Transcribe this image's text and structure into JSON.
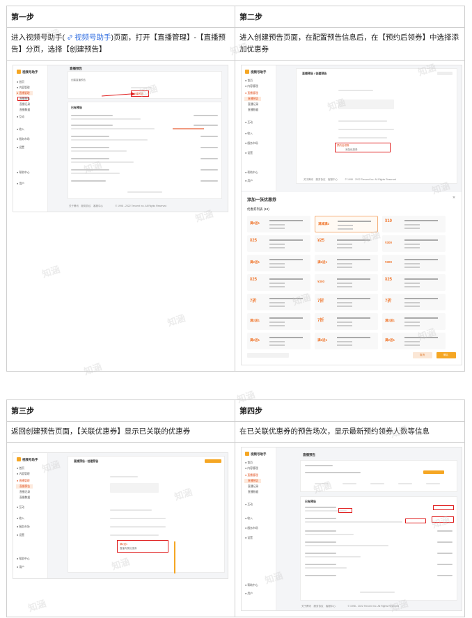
{
  "steps": [
    {
      "header": "第一步",
      "desc_pre": "进入视频号助手(",
      "desc_link": "视频号助手",
      "desc_post": ")页面，打开【直播管理】-【直播预告】分页，选择【创建预告】"
    },
    {
      "header": "第二步",
      "desc": "进入创建预告页面，在配置预告信息后，在【预约后领券】中选择添加优惠券"
    },
    {
      "header": "第三步",
      "desc": "返回创建预告页面，【关联优惠券】显示已关联的优惠券"
    },
    {
      "header": "第四步",
      "desc": "在已关联优惠券的预告场次，显示最新预约领券人数等信息"
    }
  ],
  "shot1": {
    "app_name": "视频号助手",
    "panel_title": "直播预告",
    "sub_title": "创建预告",
    "section": "已有预告"
  },
  "shot2": {
    "app_name": "视频号助手",
    "panel_title": "直播预告 / 创建预告",
    "dialog_title": "添加一张优惠券",
    "dialog_sub": "优惠券列表 (18)",
    "coupon_tags": [
      "满2送1",
      "满减满2",
      "¥10",
      "¥25",
      "¥25",
      "¥300",
      "满2送1",
      "满2送1",
      "¥300",
      "¥25",
      "¥300",
      "¥25",
      "7折",
      "7折",
      "7折",
      "满2送1",
      "7折",
      "满2送1",
      "满2送1",
      "满2送1",
      "满2送1"
    ],
    "cancel": "取消",
    "confirm": "确认"
  },
  "shot3": {
    "app_name": "视频号助手",
    "panel_title": "直播预告 / 创建预告"
  },
  "shot4": {
    "app_name": "视频号助手",
    "panel_title": "直播预告",
    "section": "已有预告"
  },
  "watermark": "知涵"
}
